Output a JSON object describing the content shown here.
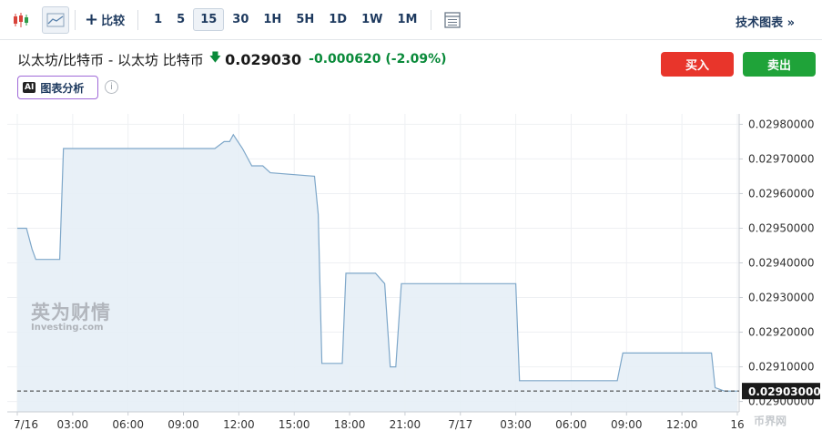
{
  "toolbar": {
    "compare_label": "比较",
    "intervals": [
      "1",
      "5",
      "15",
      "30",
      "1H",
      "5H",
      "1D",
      "1W",
      "1M"
    ],
    "active_interval": "15",
    "tech_chart_label": "技术图表 »"
  },
  "header": {
    "pair": "以太坊/比特币 - 以太坊 比特币",
    "price": "0.029030",
    "change": "-0.000620 (-2.09%)",
    "buy_label": "买入",
    "sell_label": "卖出",
    "ai_badge": "AI",
    "ai_label": "图表分析",
    "info_icon": "i"
  },
  "colors": {
    "accent": "#1e3a5f",
    "down_green": "#0a8a3a",
    "buy": "#e8352b",
    "sell": "#1fa339",
    "line": "#7ea7c9",
    "area": "#e5eef6"
  },
  "watermark": {
    "cn": "英为财情",
    "en": "Investing.com",
    "right": "币界网"
  },
  "chart_data": {
    "type": "area",
    "title": "",
    "xlabel": "",
    "ylabel": "",
    "y_ticks": [
      "0.02980000",
      "0.02970000",
      "0.02960000",
      "0.02950000",
      "0.02940000",
      "0.02930000",
      "0.02920000",
      "0.02910000",
      "0.02900000"
    ],
    "y_tick_values": [
      0.0298,
      0.0297,
      0.0296,
      0.0295,
      0.0294,
      0.0293,
      0.0292,
      0.0291,
      0.029
    ],
    "x_ticks": [
      "7/16",
      "03:00",
      "06:00",
      "09:00",
      "12:00",
      "15:00",
      "18:00",
      "21:00",
      "7/17",
      "03:00",
      "06:00",
      "09:00",
      "12:00",
      "16"
    ],
    "x_tick_hours": [
      0,
      3,
      6,
      9,
      12,
      15,
      18,
      21,
      24,
      27,
      30,
      33,
      36,
      39
    ],
    "ylim": [
      0.02897,
      0.02983
    ],
    "xlim": [
      0,
      39.1
    ],
    "current_price_label": "0.02903000",
    "current_price": 0.02903,
    "grid": true,
    "series": [
      {
        "x": [
          0,
          0.5,
          0.8,
          1.0,
          2.3,
          2.5,
          10.7,
          11.2,
          11.5,
          11.7,
          12.2,
          12.7,
          13.3,
          13.7,
          16.1,
          16.3,
          16.5,
          17.6,
          17.8,
          19.4,
          19.9,
          20.2,
          20.5,
          20.8,
          21.0,
          27.0,
          27.2,
          32.5,
          32.8,
          37.6,
          37.8,
          38.3,
          39.0
        ],
        "values": [
          0.0295,
          0.0295,
          0.02944,
          0.02941,
          0.02941,
          0.02973,
          0.02973,
          0.02975,
          0.02975,
          0.02977,
          0.02973,
          0.02968,
          0.02968,
          0.02966,
          0.02965,
          0.02954,
          0.02911,
          0.02911,
          0.02937,
          0.02937,
          0.02934,
          0.0291,
          0.0291,
          0.02934,
          0.02934,
          0.02934,
          0.02906,
          0.02906,
          0.02914,
          0.02914,
          0.02904,
          0.02903,
          0.02903
        ]
      }
    ]
  }
}
